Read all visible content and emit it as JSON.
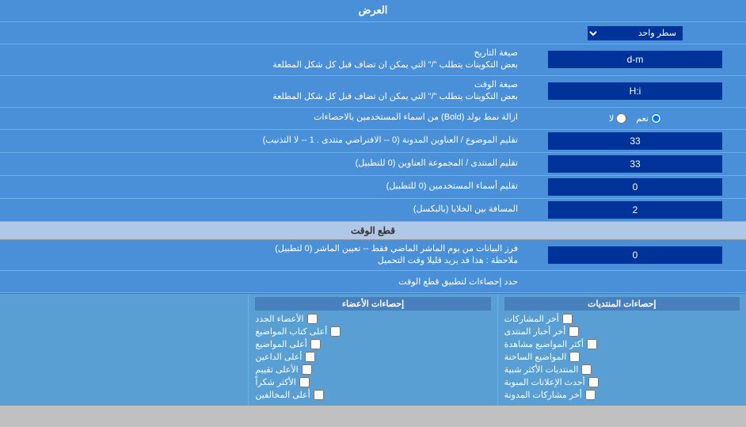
{
  "title": "العرض",
  "rows": [
    {
      "id": "display-mode",
      "label": "العرض",
      "inputType": "select",
      "value": "سطر واحد"
    },
    {
      "id": "date-format",
      "label": "صيغة التاريخ\nبعض التكوينات يتطلب \"/\" التي يمكن ان تضاف قبل كل شكل المطلعة",
      "inputType": "text",
      "value": "d-m"
    },
    {
      "id": "time-format",
      "label": "صيغة الوقت\nبعض التكوينات يتطلب \"/\" التي يمكن ان تضاف قبل كل شكل المطلعة",
      "inputType": "text",
      "value": "H:i"
    },
    {
      "id": "bold-remove",
      "label": "ازالة نمط بولد (Bold) من اسماء المستخدمين بالاحصاءات",
      "inputType": "radio",
      "options": [
        "نعم",
        "لا"
      ],
      "selected": "نعم"
    },
    {
      "id": "topics-order",
      "label": "تقليم الموضوع / العناوين المدونة (0 -- الافتراضي منتدى . 1 -- لا التذنيب)",
      "inputType": "text",
      "value": "33"
    },
    {
      "id": "forum-order",
      "label": "تقليم المنتدى / المجموعة العناوين (0 للتطبيل)",
      "inputType": "text",
      "value": "33"
    },
    {
      "id": "usernames-trim",
      "label": "تقليم أسماء المستخدمين (0 للتطبيل)",
      "inputType": "text",
      "value": "0"
    },
    {
      "id": "gap",
      "label": "المسافة بين الخلايا (بالبكسل)",
      "inputType": "text",
      "value": "2"
    }
  ],
  "section_cutoff": {
    "header": "قطع الوقت",
    "row": {
      "label": "فرز البيانات من يوم الماشر الماضي فقط -- تعيين الماشر (0 لتطبيل)\nملاحظة : هذا قد يزيد قليلا وقت التحميل",
      "value": "0"
    },
    "limit_label": "حدد إحصاءات لتطبيق قطع الوقت"
  },
  "checkboxes": {
    "col1_title": "إحصاءات المنتديات",
    "col1_items": [
      "أخر المشاركات",
      "أخر أخبار المنتدى",
      "أكثر المواضيع مشاهدة",
      "المواضيع الساخنة",
      "المنتديات الأكثر شبية",
      "أحدث الإعلانات المبوبة",
      "أخر مشاركات المدونة"
    ],
    "col2_title": "إحصاءات الأعضاء",
    "col2_items": [
      "الأعضاء الجدد",
      "أعلى كتاب المواضيع",
      "أعلى المواضيع",
      "أعلى الداعين",
      "الأعلى تقييم",
      "الأكثر شكراً",
      "أعلى المخالفين"
    ]
  }
}
